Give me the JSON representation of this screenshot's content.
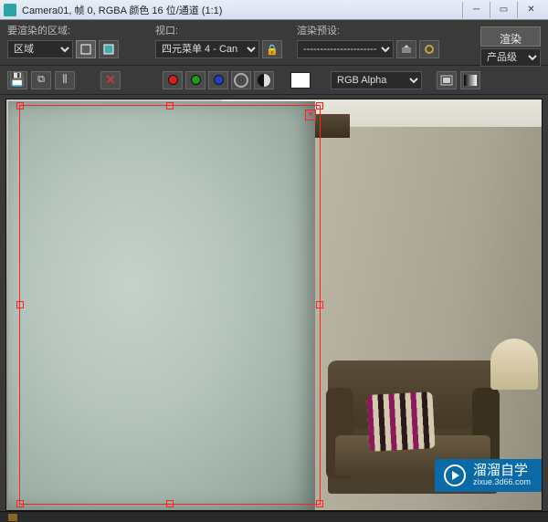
{
  "titlebar": {
    "title": "Camera01, 帧 0, RGBA 颜色 16 位/通道 (1:1)"
  },
  "toolbar": {
    "region_label": "要渲染的区域:",
    "region_value": "区域",
    "viewport_label": "视口:",
    "viewport_value": "四元菜单 4 - Can",
    "preset_label": "渲染预设:",
    "preset_value": "-----------------------",
    "product_value": "产品级",
    "render_button": "渲染",
    "alpha_value": "RGB Alpha"
  },
  "watermark": {
    "brand": "溜溜自学",
    "sub": "zixue.3d66.com"
  }
}
